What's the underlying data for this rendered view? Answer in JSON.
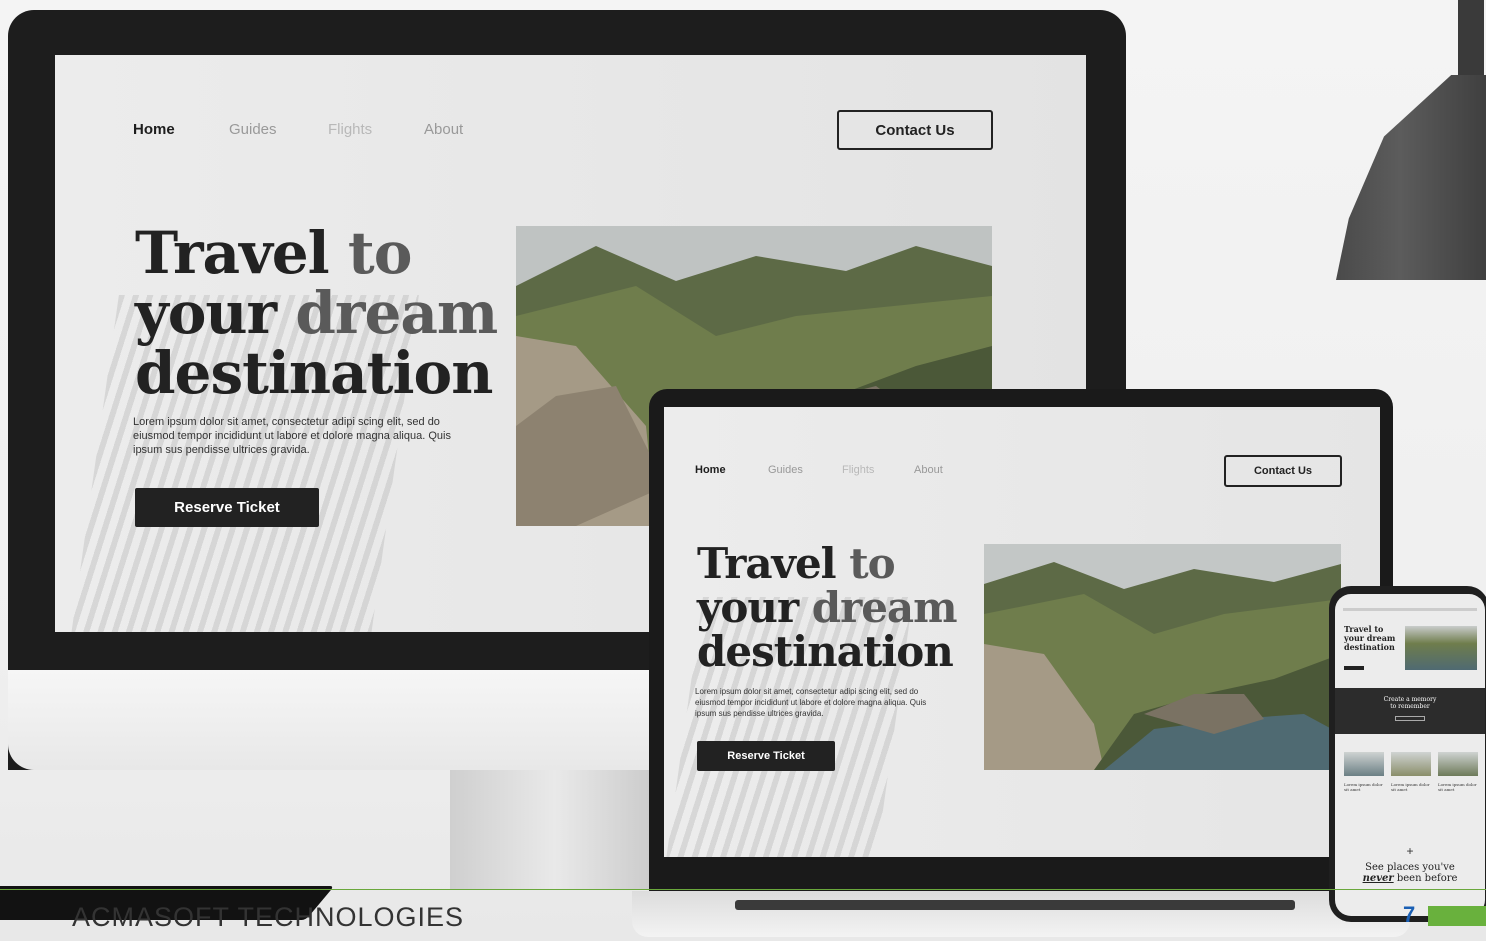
{
  "desktop": {
    "nav": {
      "home": "Home",
      "guides": "Guides",
      "flights": "Flights",
      "about": "About"
    },
    "contact_label": "Contact Us",
    "hero": {
      "line1_a": "Travel",
      "line1_b": "to",
      "line2_a": "your",
      "line2_b": "dream",
      "line3": "destination",
      "body": "Lorem ipsum dolor sit amet, consectetur adipi scing elit, sed do eiusmod tempor incididunt ut labore et dolore magna aliqua. Quis ipsum sus pendisse ultrices gravida."
    },
    "reserve_label": "Reserve Ticket"
  },
  "laptop": {
    "nav": {
      "home": "Home",
      "guides": "Guides",
      "flights": "Flights",
      "about": "About"
    },
    "contact_label": "Contact Us",
    "hero": {
      "line1_a": "Travel",
      "line1_b": "to",
      "line2_a": "your",
      "line2_b": "dream",
      "line3": "destination",
      "body": "Lorem ipsum dolor sit amet, consectetur adipi scing elit, sed do eiusmod tempor incididunt ut labore et dolore magna aliqua. Quis ipsum sus pendisse ultrices gravida."
    },
    "reserve_label": "Reserve Ticket"
  },
  "phone": {
    "hero_line1": "Travel to",
    "hero_line2": "your dream",
    "hero_line3": "destination",
    "banner_line1": "Create a memory",
    "banner_line2": "to remember",
    "card_title": "Lorem ipsum dolor sit amet",
    "plus": "+",
    "bottom_line1_a": "See places you've",
    "bottom_line2_a": "never",
    "bottom_line2_b": "been before"
  },
  "footer": {
    "brand": "ACMASOFT TECHNOLOGIES",
    "page_number": "7"
  },
  "colors": {
    "accent_green": "#69b13d",
    "page_number_blue": "#1a5fb4",
    "button_dark": "#222222"
  }
}
